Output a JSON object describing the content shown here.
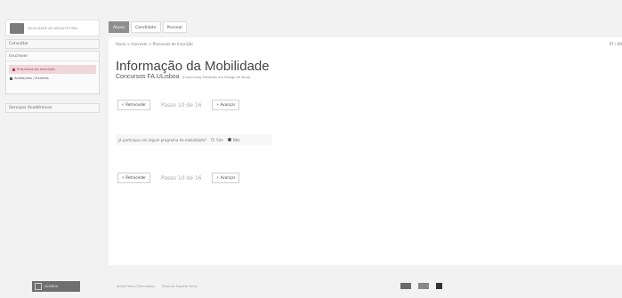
{
  "header": {
    "logo_text": "FACULDADE DE ARQUITETURA",
    "tabs": [
      {
        "label": "Aluno",
        "active": true
      },
      {
        "label": "Candidato",
        "active": false
      },
      {
        "label": "Pessoal",
        "active": false
      }
    ]
  },
  "sidebar": {
    "consultar": "Consultar",
    "inscrever": "Inscrever",
    "sub_items": [
      "Processos de Inscrição",
      "Avaliações / Exames"
    ],
    "servicos": "Serviços Académicos"
  },
  "main": {
    "breadcrumb": "Aluno > Inscrever > Processos de Inscrição",
    "language": "PT / EN",
    "title": "Informação da Mobilidade",
    "subtitle": "Concursos FA.ULisboa",
    "subtitle_small": "(Concursos) Mestrado em Design de Moda",
    "back_label": "Retroceder",
    "forward_label": "Avançar",
    "step_label": "Passo 10 de 16",
    "question": "Já participou em algum programa de mobilidade?",
    "option_yes": "Sim",
    "option_no": "Não",
    "selected_option": "Não"
  },
  "footer": {
    "logo_text": "ULISBOA",
    "links": [
      "Apoio Fenix (Formulário)",
      "Fenix do Suporte Fenix"
    ]
  }
}
